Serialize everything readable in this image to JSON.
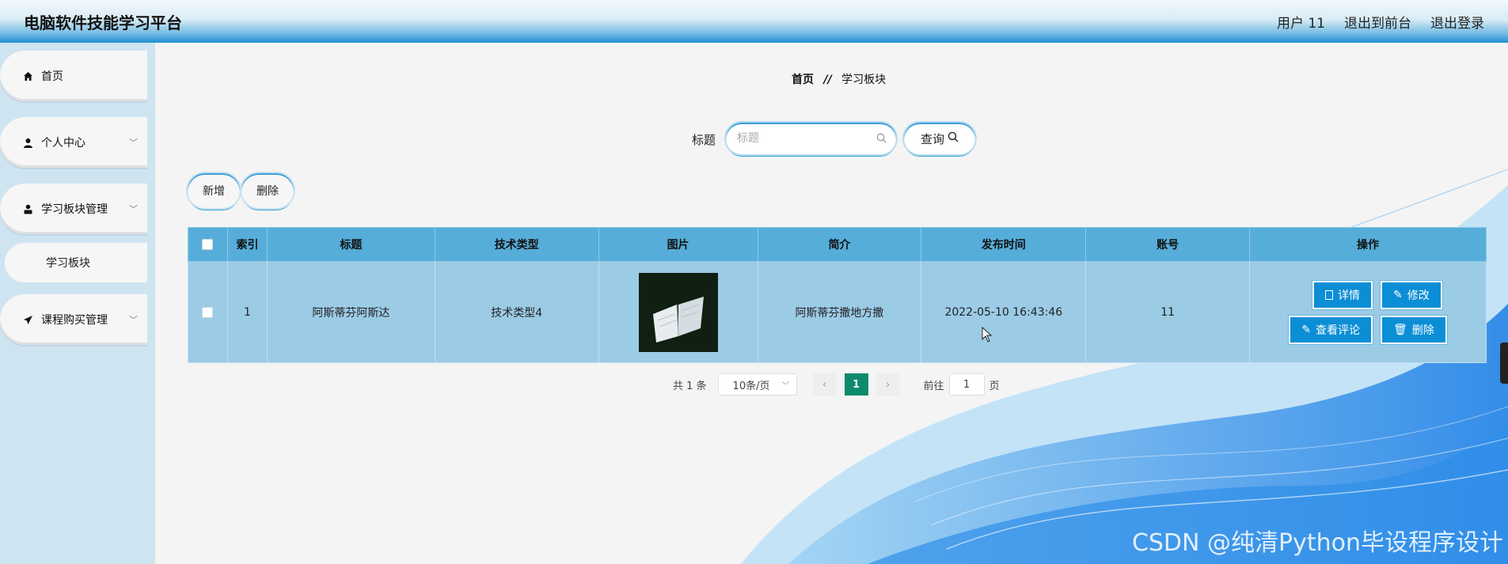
{
  "header": {
    "title": "电脑软件技能学习平台",
    "user": "用户 11",
    "to_front": "退出到前台",
    "logout": "退出登录"
  },
  "sidebar": {
    "items": [
      {
        "label": "首页",
        "icon": "home-icon"
      },
      {
        "label": "个人中心",
        "icon": "user-icon"
      },
      {
        "label": "学习板块管理",
        "icon": "person-badge-icon"
      },
      {
        "label": "课程购买管理",
        "icon": "send-icon"
      }
    ],
    "sub_item": "学习板块"
  },
  "breadcrumb": {
    "home": "首页",
    "sep": "//",
    "current": "学习板块"
  },
  "search": {
    "label": "标题",
    "placeholder": "标题",
    "button": "查询"
  },
  "actions": {
    "add": "新增",
    "delete": "删除"
  },
  "table": {
    "headers": [
      "索引",
      "标题",
      "技术类型",
      "图片",
      "简介",
      "发布时间",
      "账号",
      "操作"
    ],
    "row": {
      "index": "1",
      "title": "阿斯蒂芬阿斯达",
      "tech_type": "技术类型4",
      "intro": "阿斯蒂芬撒地方撒",
      "publish_time": "2022-05-10 16:43:46",
      "account": "11",
      "ops": {
        "detail": "详情",
        "edit": "修改",
        "comments": "查看评论",
        "delete": "删除"
      }
    }
  },
  "pagination": {
    "total": "共 1 条",
    "page_size": "10条/页",
    "current": "1",
    "goto_prefix": "前往",
    "goto_value": "1",
    "goto_suffix": "页"
  },
  "watermark": "CSDN @纯清Python毕设程序设计",
  "colors": {
    "accent": "#0c8ed6",
    "header_bottom": "#1e8fd0",
    "table_header": "#56add9",
    "table_row": "#9ccbe6",
    "page_active": "#0b8a6c"
  }
}
